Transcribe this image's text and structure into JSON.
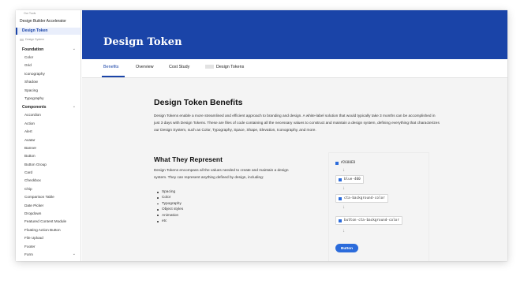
{
  "sidebar": {
    "top_label": "Our Tools",
    "tool_accelerator": "Design Builder Accelerator",
    "active_item": "Design Token",
    "design_system_label": "Design System",
    "foundation_label": "Foundation",
    "foundation_items": [
      "Color",
      "Grid",
      "Iconography",
      "Shadow",
      "Spacing",
      "Typography"
    ],
    "components_label": "Components",
    "component_items": [
      "Accordion",
      "Action",
      "Alert",
      "Avatar",
      "Banner",
      "Button",
      "Button Group",
      "Card",
      "Checkbox",
      "Chip",
      "Comparison Table",
      "Date Picker",
      "Dropdown",
      "Featured Content Module",
      "Floating Action Button",
      "File Upload",
      "Footer"
    ],
    "forms_label": "Form"
  },
  "header": {
    "title": "Design Token",
    "bg_color": "#1a44a8"
  },
  "tabs": [
    {
      "label": "Benefits",
      "active": true
    },
    {
      "label": "Overview",
      "active": false
    },
    {
      "label": "Cost Study",
      "active": false
    },
    {
      "label": "Design Tokens",
      "active": false
    }
  ],
  "content": {
    "title": "Design Token Benefits",
    "intro": "Design Tokens enable a more streamlined and efficient approach to branding and design. A white-label solution that would typically take 3 months can be accomplished in just 3 days with Design Tokens. These are files of code containing all the necessary values to construct and maintain a design system, defining everything that characterizes our Design System, such as Color, Typography, Space, Shape, Elevation, Iconography, and more.",
    "subtitle": "What They Represent",
    "represent_text": "Design Tokens encompass all the values needed to create and maintain a design system. They can represent anything defined by design, including:",
    "list": [
      "Spacing",
      "Color",
      "Typography",
      "Object styles",
      "Animation",
      "etc"
    ]
  },
  "token_diagram": {
    "tokens": [
      "#2680EB",
      "blue-400",
      "cta-background-color",
      "button-cta-background-color"
    ],
    "arrow": "↓",
    "button_label": "Button",
    "accent_color": "#2b6bdb"
  }
}
